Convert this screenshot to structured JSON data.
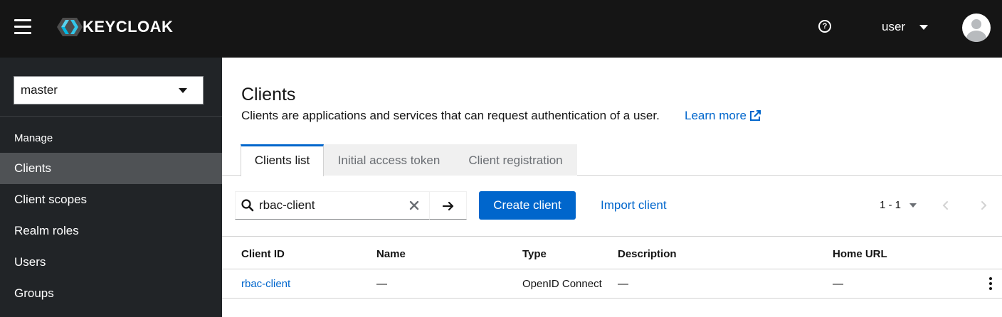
{
  "header": {
    "logo_text": "KEYCLOAK",
    "user_label": "user"
  },
  "sidebar": {
    "realm": "master",
    "section_label": "Manage",
    "items": [
      {
        "label": "Clients",
        "active": true
      },
      {
        "label": "Client scopes",
        "active": false
      },
      {
        "label": "Realm roles",
        "active": false
      },
      {
        "label": "Users",
        "active": false
      },
      {
        "label": "Groups",
        "active": false
      }
    ]
  },
  "main": {
    "title": "Clients",
    "description": "Clients are applications and services that can request authentication of a user.",
    "learn_more": "Learn more",
    "tabs": [
      {
        "label": "Clients list",
        "active": true
      },
      {
        "label": "Initial access token",
        "active": false
      },
      {
        "label": "Client registration",
        "active": false
      }
    ],
    "toolbar": {
      "search_value": "rbac-client",
      "create_label": "Create client",
      "import_label": "Import client",
      "pagination": "1 - 1"
    },
    "table": {
      "columns": [
        "Client ID",
        "Name",
        "Type",
        "Description",
        "Home URL"
      ],
      "rows": [
        {
          "client_id": "rbac-client",
          "name": "—",
          "type": "OpenID Connect",
          "description": "—",
          "home_url": "—"
        }
      ]
    }
  },
  "colors": {
    "masthead": "#151515",
    "sidebar": "#212427",
    "sidebar_active": "#4f5255",
    "primary": "#0066cc"
  }
}
